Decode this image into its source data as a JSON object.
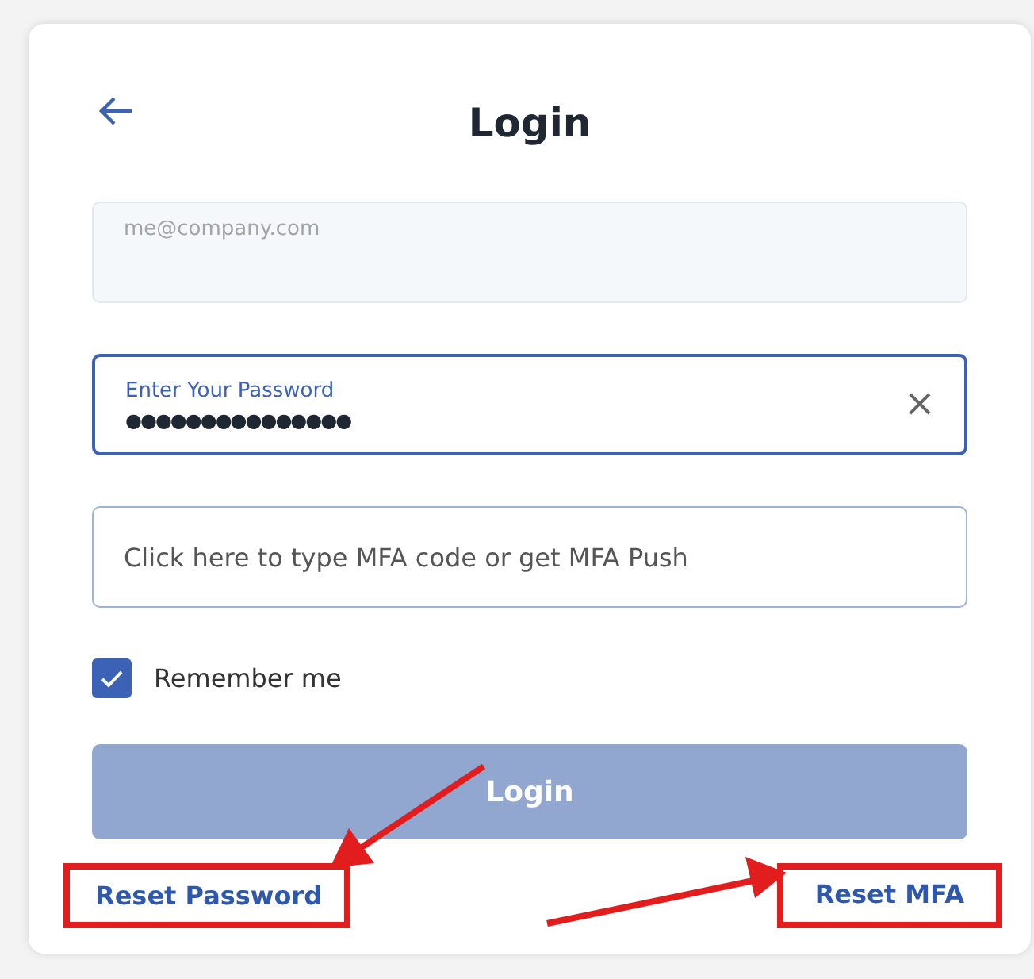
{
  "title": "Login",
  "email": {
    "placeholder": "me@company.com"
  },
  "password": {
    "label": "Enter Your Password",
    "value": "●●●●●●●●●●●●●●●",
    "focused": true,
    "clear": "×"
  },
  "mfa": {
    "placeholder": "Click here to type MFA code or get MFA Push"
  },
  "remember": {
    "label": "Remember me",
    "checked": true
  },
  "login_button": {
    "label": "Login",
    "disabled": true
  },
  "links": [
    {
      "label": "Reset Password",
      "highlighted": true
    },
    {
      "label": "Reset MFA",
      "highlighted": true
    }
  ]
}
